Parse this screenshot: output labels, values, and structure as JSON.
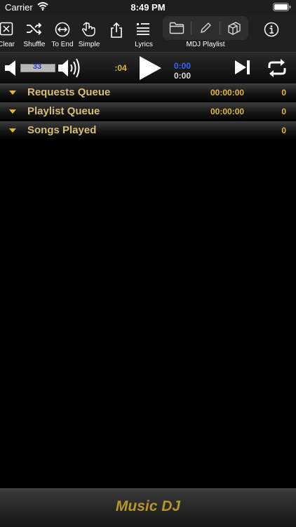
{
  "status_bar": {
    "carrier": "Carrier",
    "time": "8:49 PM"
  },
  "toolbar": {
    "items": [
      {
        "label": "Clear",
        "icon": "clear-icon"
      },
      {
        "label": "Shuffle",
        "icon": "shuffle-icon"
      },
      {
        "label": "To End",
        "icon": "to-end-icon"
      },
      {
        "label": "Simple",
        "icon": "hand-icon"
      },
      {
        "label": "",
        "icon": "share-icon"
      },
      {
        "label": "Lyrics",
        "icon": "lyrics-icon"
      }
    ],
    "segment_label": "MDJ Playlist",
    "segment_icons": [
      "folder-icon",
      "pencil-icon",
      "boxes-icon"
    ],
    "info_icon": "info-icon"
  },
  "player": {
    "volume": "33",
    "elapsed": ":04",
    "current_time": "0:00",
    "total_time": "0:00"
  },
  "sections": [
    {
      "title": "Requests Queue",
      "duration": "00:00:00",
      "count": "0"
    },
    {
      "title": "Playlist Queue",
      "duration": "00:00:00",
      "count": "0"
    },
    {
      "title": "Songs Played",
      "duration": "",
      "count": "0"
    }
  ],
  "footer": {
    "app_name": "Music DJ"
  },
  "colors": {
    "accent_gold": "#e0b93a",
    "time_blue": "#3b64ff",
    "volume_blue": "#2a3acc"
  }
}
